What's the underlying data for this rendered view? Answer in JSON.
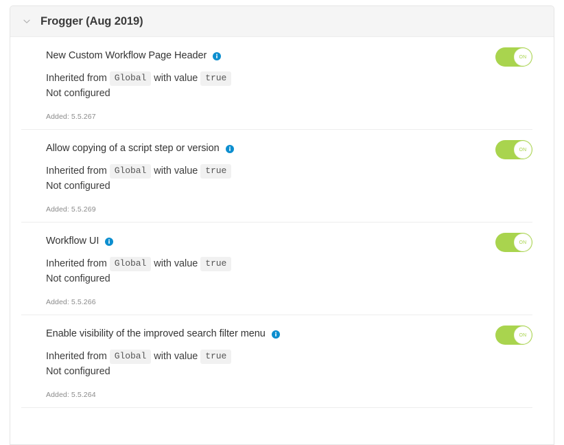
{
  "panel": {
    "title": "Frogger (Aug 2019)",
    "collapse_icon": "chevron-down-icon",
    "expanded": true
  },
  "labels": {
    "inherited_prefix": "Inherited from",
    "with_value": "with value",
    "not_configured": "Not configured",
    "info_icon": "info-icon",
    "toggle_on_label": "ON"
  },
  "colors": {
    "toggle_on": "#a9d44e",
    "info_icon": "#0c8ecf",
    "header_bg": "#f5f5f5",
    "chip_bg": "#f1f1f1",
    "title_text": "#3b3b3b"
  },
  "features": [
    {
      "name": "New Custom Workflow Page Header",
      "inherited_from": "Global",
      "value": "true",
      "configured_state": "Not configured",
      "added": "Added: 5.5.267",
      "toggle": "ON"
    },
    {
      "name": "Allow copying of a script step or version",
      "inherited_from": "Global",
      "value": "true",
      "configured_state": "Not configured",
      "added": "Added: 5.5.269",
      "toggle": "ON"
    },
    {
      "name": "Workflow UI",
      "inherited_from": "Global",
      "value": "true",
      "configured_state": "Not configured",
      "added": "Added: 5.5.266",
      "toggle": "ON"
    },
    {
      "name": "Enable visibility of the improved search filter menu",
      "inherited_from": "Global",
      "value": "true",
      "configured_state": "Not configured",
      "added": "Added: 5.5.264",
      "toggle": "ON"
    }
  ]
}
